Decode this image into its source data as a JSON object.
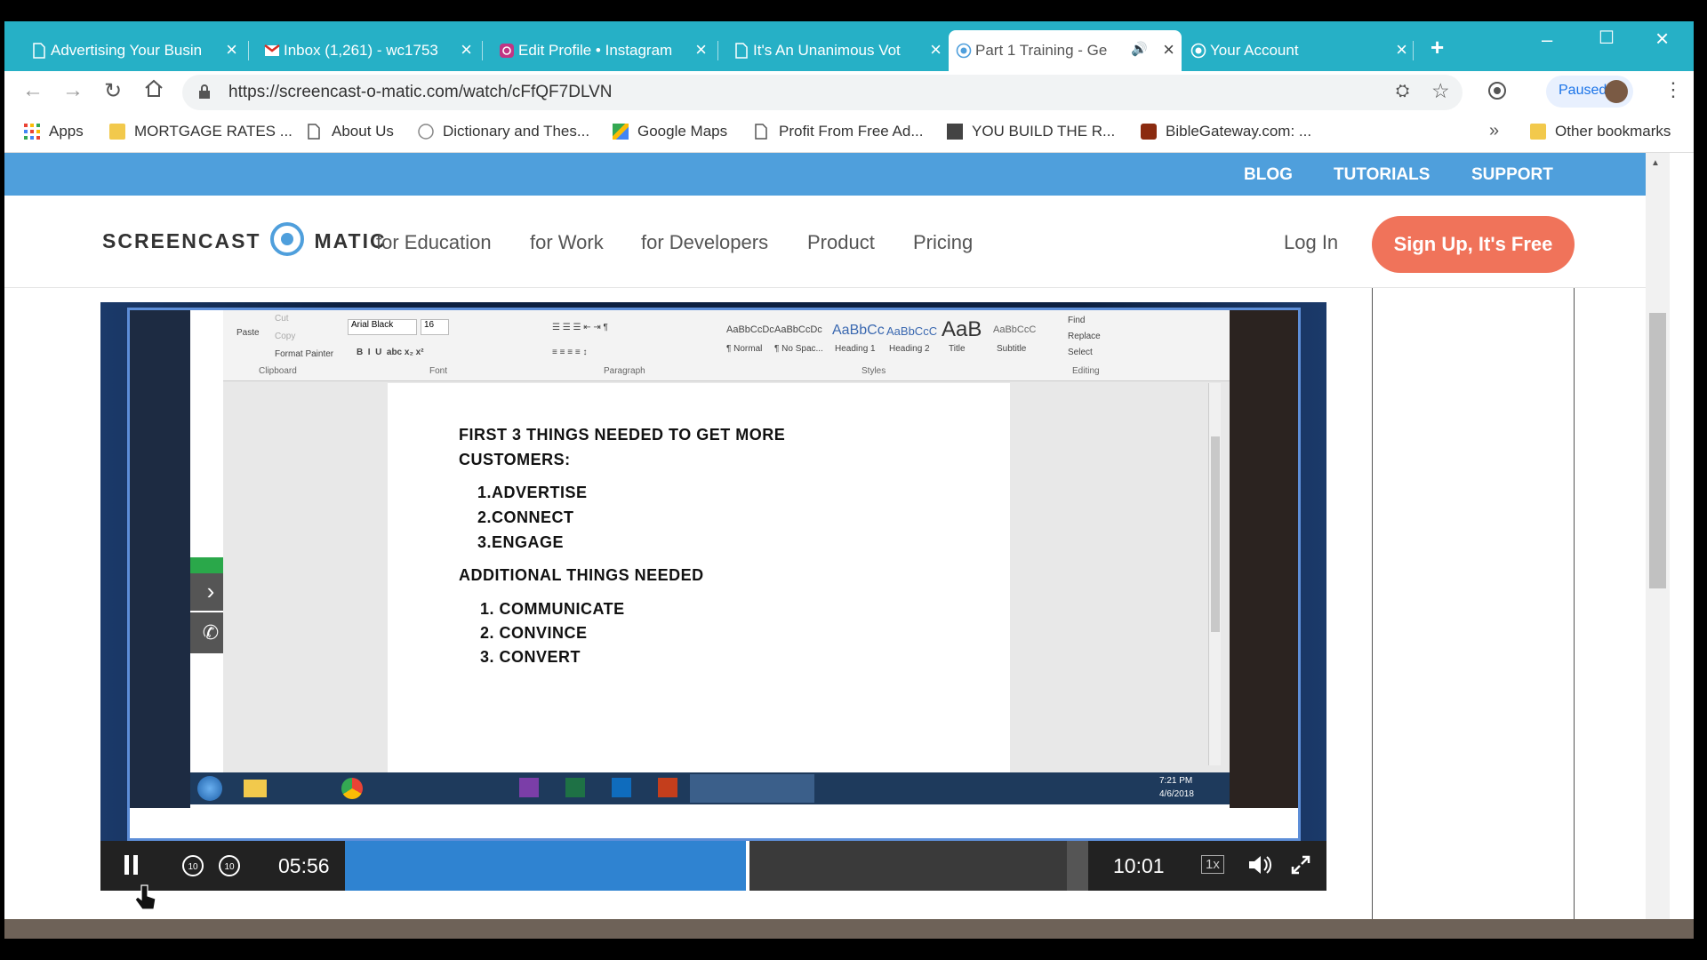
{
  "tabs": [
    {
      "title": "Advertising Your Busin",
      "icon": "document-icon"
    },
    {
      "title": "Inbox (1,261) - wc1753",
      "icon": "gmail-icon"
    },
    {
      "title": "Edit Profile • Instagram",
      "icon": "instagram-icon"
    },
    {
      "title": "It's An Unanimous Vot",
      "icon": "document-icon"
    },
    {
      "title": "Part 1 Training - Ge",
      "icon": "screencast-icon",
      "active": true
    },
    {
      "title": "Your Account",
      "icon": "screencast-icon"
    }
  ],
  "address": {
    "url": "https://screencast-o-matic.com/watch/cFfQF7DLVN"
  },
  "profile": {
    "status": "Paused"
  },
  "bookmarks": [
    {
      "label": "Apps",
      "icon": "apps-grid-icon"
    },
    {
      "label": "MORTGAGE RATES ...",
      "icon": "folder-icon"
    },
    {
      "label": "About Us",
      "icon": "document-icon"
    },
    {
      "label": "Dictionary and Thes...",
      "icon": "dictionary-icon"
    },
    {
      "label": "Google Maps",
      "icon": "maps-icon"
    },
    {
      "label": "Profit From Free Ad...",
      "icon": "document-icon"
    },
    {
      "label": "YOU  BUILD  THE  R...",
      "icon": "image-icon"
    },
    {
      "label": "BibleGateway.com: ...",
      "icon": "bible-icon"
    }
  ],
  "other_bookmarks": "Other bookmarks",
  "site": {
    "top_links": [
      "BLOG",
      "TUTORIALS",
      "SUPPORT"
    ],
    "logo_left": "SCREENCAST",
    "logo_right": "MATIC",
    "nav": [
      "for Education",
      "for Work",
      "for Developers",
      "Product",
      "Pricing"
    ],
    "login": "Log In",
    "signup": "Sign Up, It's Free"
  },
  "document": {
    "heading_line1": "FIRST 3 THINGS  NEEDED TO GET MORE",
    "heading_line2": "CUSTOMERS:",
    "list1": [
      "1.ADVERTISE",
      "2.CONNECT",
      "3.ENGAGE"
    ],
    "heading2": "ADDITIONAL THINGS NEEDED",
    "list2": [
      "1.  COMMUNICATE",
      "2.  CONVINCE",
      "3.  CONVERT"
    ]
  },
  "ribbon": {
    "font_name": "Arial Black",
    "font_size": "16",
    "styles": [
      "¶ Normal",
      "¶ No Spac...",
      "Heading 1",
      "Heading 2",
      "Title",
      "Subtitle"
    ],
    "groups": [
      "Clipboard",
      "Font",
      "Paragraph",
      "Styles",
      "Editing"
    ],
    "editing": [
      "Find",
      "Replace",
      "Select"
    ],
    "clipboard": [
      "Cut",
      "Copy",
      "Format Painter",
      "Paste"
    ]
  },
  "taskbar": {
    "time": "7:21 PM",
    "date": "4/6/2018"
  },
  "player": {
    "current_time": "05:56",
    "duration": "10:01",
    "speed": "1x",
    "progress_fraction": 0.54,
    "buffered_fraction": 0.84
  },
  "colors": {
    "tabbar": "#26b0c6",
    "topnav": "#4f9fdc",
    "signup": "#f0735a",
    "progress": "#2f83d1"
  }
}
